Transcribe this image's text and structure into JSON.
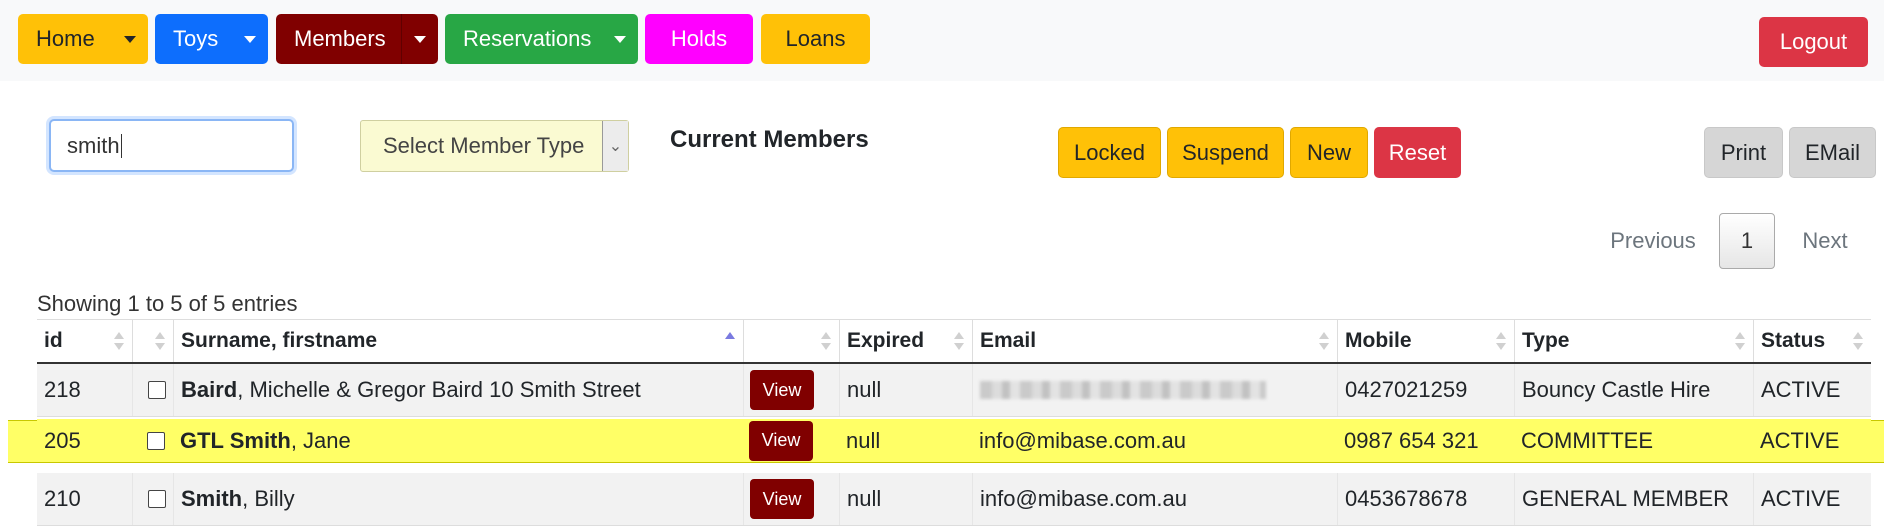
{
  "nav": {
    "home": "Home",
    "toys": "Toys",
    "members": "Members",
    "reservations": "Reservations",
    "holds": "Holds",
    "loans": "Loans",
    "logout": "Logout"
  },
  "colors": {
    "home": "#ffc107",
    "toys": "#0d6efd",
    "members": "#800000",
    "reservations": "#28a745",
    "holds": "#ff00ff",
    "loans": "#ffc107"
  },
  "search": {
    "value": "smith"
  },
  "member_type": {
    "selected": "Select Member Type"
  },
  "section_title": "Current Members",
  "actions": {
    "locked": "Locked",
    "suspend": "Suspend",
    "new": "New",
    "reset": "Reset",
    "print": "Print",
    "email": "EMail"
  },
  "pagination": {
    "previous": "Previous",
    "page": "1",
    "next": "Next"
  },
  "showing": "Showing 1 to 5 of 5 entries",
  "table": {
    "headers": [
      "id",
      "",
      "Surname, firstname",
      "",
      "Expired",
      "Email",
      "Mobile",
      "Type",
      "Status"
    ],
    "view_label": "View",
    "rows": [
      {
        "id": "218",
        "surname": "Baird",
        "rest": ", Michelle & Gregor Baird 10 Smith Street",
        "expired": "null",
        "email": "",
        "mobile": "0427021259",
        "type": "Bouncy Castle Hire",
        "status": "ACTIVE"
      },
      {
        "id": "205",
        "surname": "GTL Smith",
        "rest": ", Jane",
        "expired": "null",
        "email": "info@mibase.com.au",
        "mobile": "0987 654 321",
        "type": "COMMITTEE",
        "status": "ACTIVE"
      },
      {
        "id": "210",
        "surname": "Smith",
        "rest": ", Billy",
        "expired": "null",
        "email": "info@mibase.com.au",
        "mobile": "0453678678",
        "type": "GENERAL MEMBER",
        "status": "ACTIVE"
      }
    ]
  }
}
